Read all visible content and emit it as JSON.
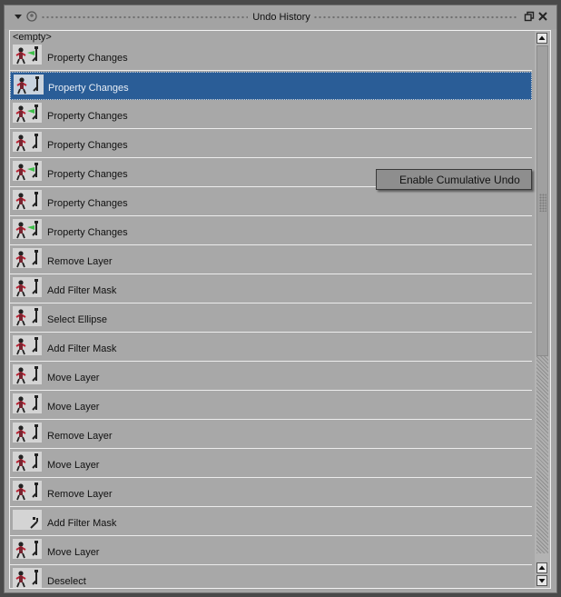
{
  "panel": {
    "title": "Undo History",
    "icons": {
      "menu": "menu-arrow-icon",
      "dock": "dock-circle-icon",
      "float": "float-window-icon",
      "close": "close-icon"
    }
  },
  "list": {
    "empty_label": "<empty>",
    "selected_index": 1,
    "items": [
      {
        "label": "Property Changes",
        "thumb": "green"
      },
      {
        "label": "Property Changes",
        "thumb": "plain"
      },
      {
        "label": "Property Changes",
        "thumb": "green"
      },
      {
        "label": "Property Changes",
        "thumb": "plain"
      },
      {
        "label": "Property Changes",
        "thumb": "green"
      },
      {
        "label": "Property Changes",
        "thumb": "plain"
      },
      {
        "label": "Property Changes",
        "thumb": "green"
      },
      {
        "label": "Remove Layer",
        "thumb": "plain"
      },
      {
        "label": "Add Filter Mask",
        "thumb": "plain"
      },
      {
        "label": "Select Ellipse",
        "thumb": "plain"
      },
      {
        "label": "Add Filter Mask",
        "thumb": "plain"
      },
      {
        "label": "Move Layer",
        "thumb": "plain"
      },
      {
        "label": "Move Layer",
        "thumb": "plain"
      },
      {
        "label": "Remove Layer",
        "thumb": "plain"
      },
      {
        "label": "Move Layer",
        "thumb": "plain"
      },
      {
        "label": "Remove Layer",
        "thumb": "plain"
      },
      {
        "label": "Add Filter Mask",
        "thumb": "blank"
      },
      {
        "label": "Move Layer",
        "thumb": "plain"
      },
      {
        "label": "Deselect",
        "thumb": "plain"
      }
    ]
  },
  "context_menu": {
    "items": [
      "Enable Cumulative Undo"
    ]
  },
  "colors": {
    "panel_bg": "#a6a6a6",
    "selection": "#2a5d97",
    "accent_green": "#3fbf4a"
  }
}
